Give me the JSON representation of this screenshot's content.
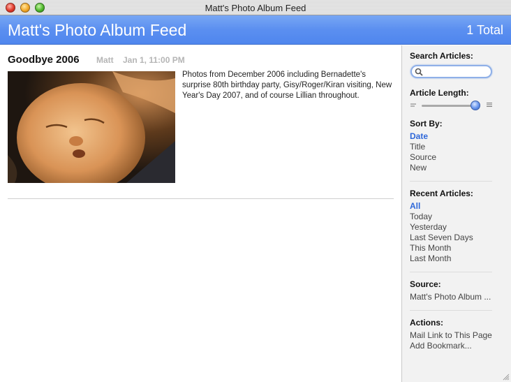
{
  "window": {
    "title": "Matt's Photo Album Feed"
  },
  "header": {
    "title": "Matt's Photo Album Feed",
    "count": "1 Total"
  },
  "article": {
    "title": "Goodbye 2006",
    "author": "Matt",
    "date": "Jan 1, 11:00 PM",
    "body": "Photos from December 2006 including Bernadette's surprise 80th birthday party, Gisy/Roger/Kiran visiting, New Year's Day 2007, and of course Lillian throughout."
  },
  "sidebar": {
    "search": {
      "heading": "Search Articles:",
      "value": "",
      "placeholder": ""
    },
    "article_length": {
      "heading": "Article Length:",
      "value": 1.0
    },
    "sort_by": {
      "heading": "Sort By:",
      "items": [
        "Date",
        "Title",
        "Source",
        "New"
      ],
      "selected": "Date"
    },
    "recent_articles": {
      "heading": "Recent Articles:",
      "items": [
        "All",
        "Today",
        "Yesterday",
        "Last Seven Days",
        "This Month",
        "Last Month"
      ],
      "selected": "All"
    },
    "source": {
      "heading": "Source:",
      "items": [
        "Matt's Photo Album ..."
      ]
    },
    "actions": {
      "heading": "Actions:",
      "items": [
        "Mail Link to This Page",
        "Add Bookmark..."
      ]
    }
  },
  "colors": {
    "header_blue": "#5b8ff0",
    "link_active": "#2f68d9",
    "muted_text": "#b5b5b5"
  },
  "icons": {
    "search": "magnifier-icon",
    "resize": "resize-grip-icon"
  }
}
